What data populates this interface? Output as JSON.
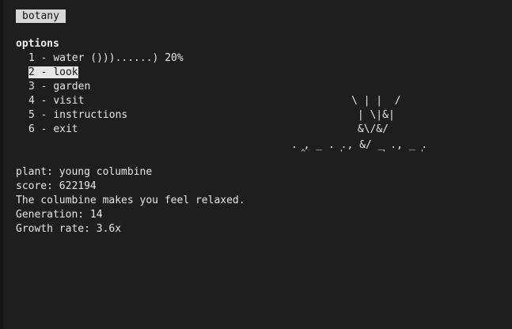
{
  "app": {
    "title": "botany"
  },
  "menu": {
    "header": "options",
    "items": [
      {
        "number": "1",
        "label": "water ()))......) 20%"
      },
      {
        "number": "2",
        "label": "look"
      },
      {
        "number": "3",
        "label": "garden"
      },
      {
        "number": "4",
        "label": "visit"
      },
      {
        "number": "5",
        "label": "instructions"
      },
      {
        "number": "6",
        "label": "exit"
      }
    ],
    "selected_index": 1
  },
  "plant_art": {
    "lines": [
      "\\ | |  /",
      " | \\|&|",
      " &\\/&/",
      ". , _ . ., &/ _ ., _ ."
    ],
    "ground_marks": "  ^       '        '       '"
  },
  "status": {
    "plant": "plant: young columbine",
    "score": "score: 622194",
    "message": "The columbine makes you feel relaxed.",
    "generation": "Generation: 14",
    "growth_rate": "Growth rate: 3.6x"
  },
  "colors": {
    "background": "#1e1e1e",
    "text": "#e6e6e6",
    "highlight": "#e6e6e6"
  }
}
